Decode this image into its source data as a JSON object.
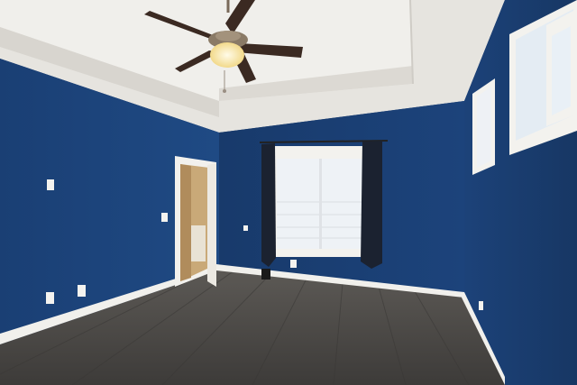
{
  "scene": {
    "subject": "empty-bedroom-interior",
    "palette": {
      "wall_blue": "#1e4880",
      "wall_blue_dark": "#173a6c",
      "ceiling": "#e9e7e2",
      "trim": "#f3f2ee",
      "floor": "#4e4c49",
      "curtain": "#1b2230",
      "window_glass": "#eef2f6",
      "fan_blade": "#3b2a22",
      "fan_light": "#fff3c8"
    },
    "icons": {
      "ceiling_fan": "ceiling-fan-icon",
      "outlet": "outlet-icon",
      "switch": "light-switch-icon"
    }
  }
}
